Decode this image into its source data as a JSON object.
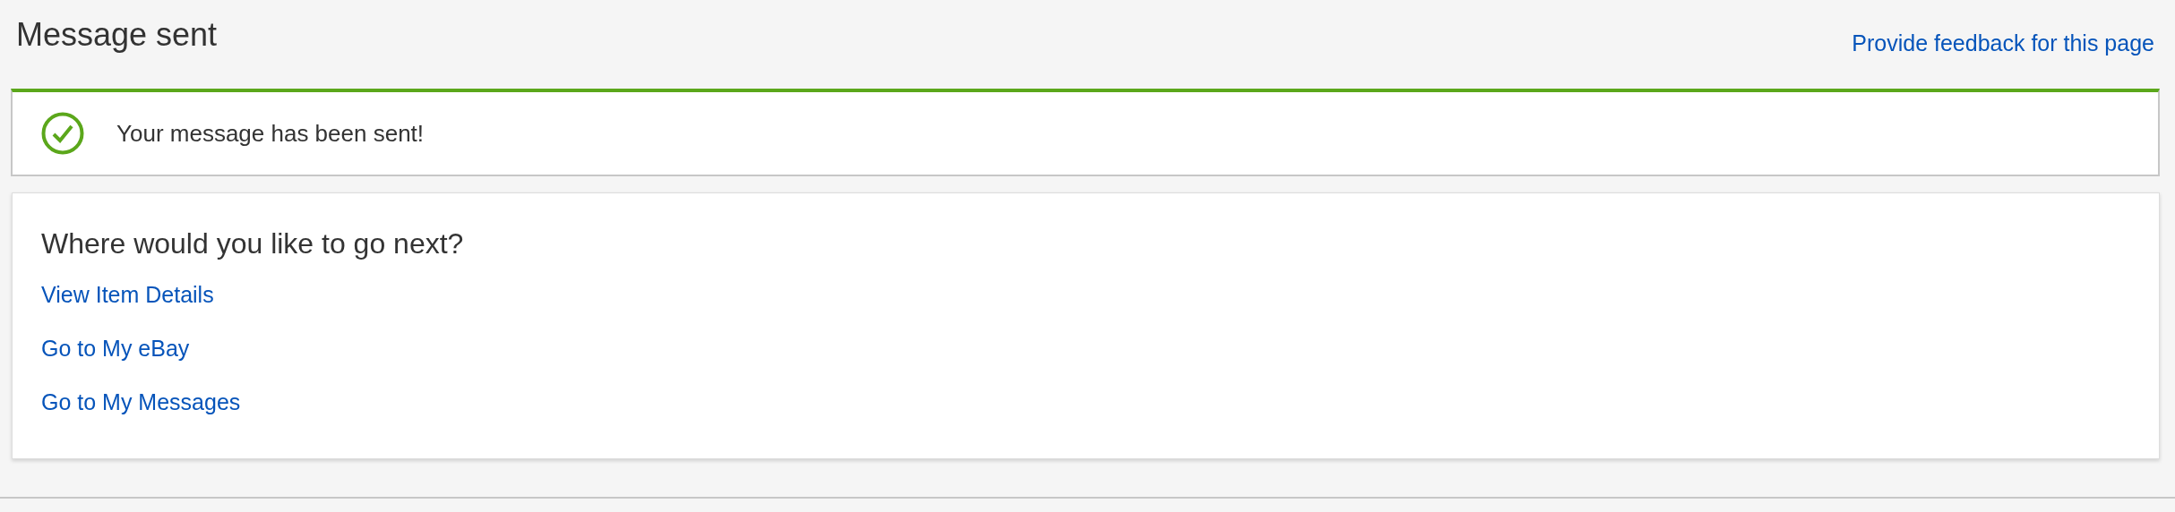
{
  "page": {
    "title": "Message sent",
    "feedback_link": "Provide feedback for this page"
  },
  "alert": {
    "kind": "success",
    "message": "Your message has been sent!"
  },
  "next_steps": {
    "heading": "Where would you like to go next?",
    "links": [
      "View Item Details",
      "Go to My eBay",
      "Go to My Messages"
    ]
  }
}
